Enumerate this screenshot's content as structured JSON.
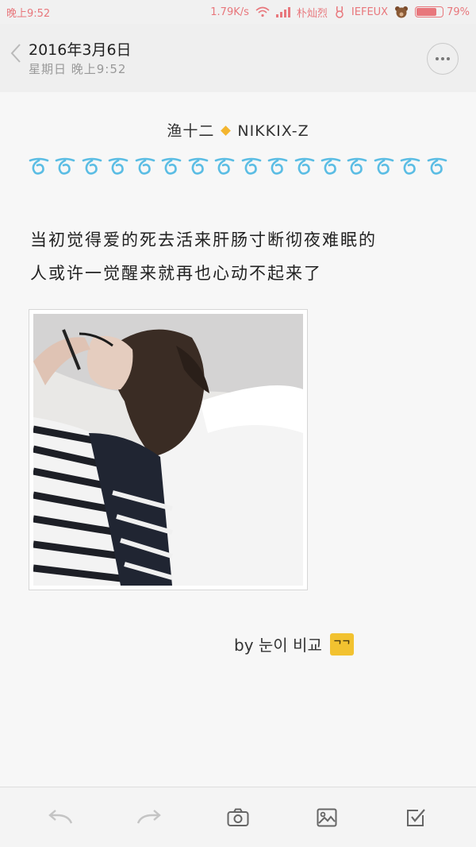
{
  "status_bar": {
    "time": "晚上9:52",
    "net_speed": "1.79K/s",
    "carrier": "朴灿烈",
    "extra": "IEFEUX",
    "battery_text": "79%",
    "battery_level": 0.79,
    "accent_color": "#e8777c"
  },
  "header": {
    "date": "2016年3月6日",
    "subtitle": "星期日 晚上9:52",
    "back_icon": "chevron-left-icon",
    "more_icon": "more-horizontal-icon"
  },
  "note": {
    "author_left": "渔十二",
    "author_right": "NIKKIX-Z",
    "deco_count": 16,
    "deco_color": "#5bbde4",
    "body_lines": [
      "当初觉得爱的死去活来肝肠寸断彻夜难眠的",
      "人或许一觉醒来就再也心动不起来了"
    ],
    "signature": "by 눈이 비교",
    "signature_badge": "ᄀᄀ",
    "badge_color": "#f2c230"
  },
  "toolbar": {
    "items": [
      "undo-icon",
      "redo-icon",
      "camera-icon",
      "image-icon",
      "checkbox-icon"
    ]
  }
}
